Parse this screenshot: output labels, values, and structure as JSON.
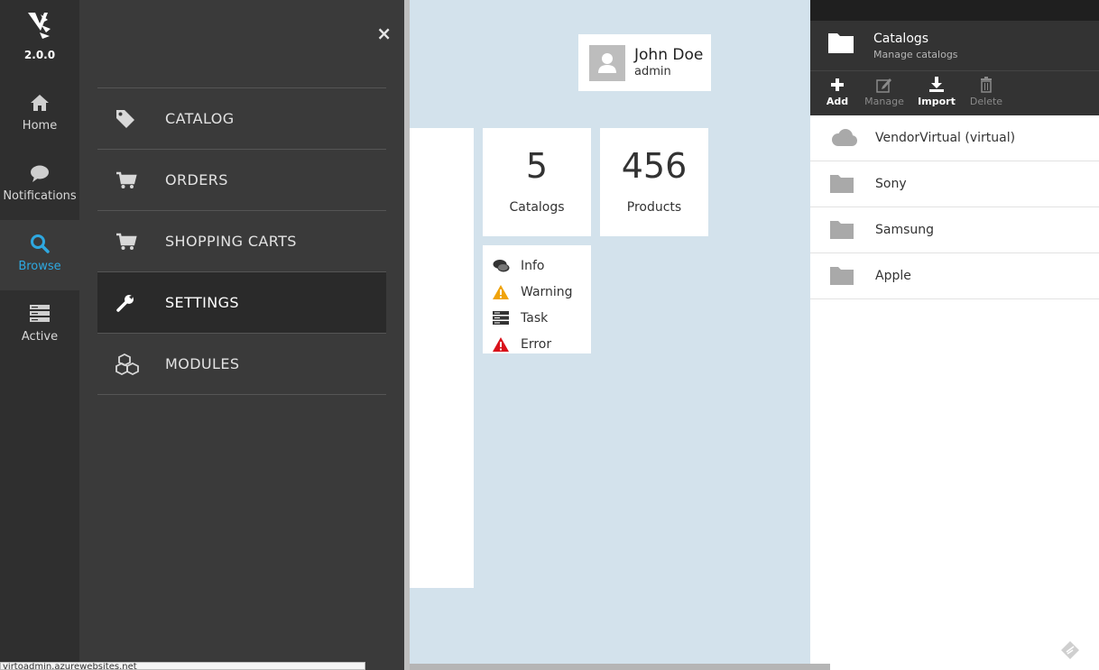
{
  "app": {
    "version": "2.0.0"
  },
  "sidebar": {
    "items": [
      {
        "label": "Home",
        "icon": "home-icon"
      },
      {
        "label": "Notifications",
        "icon": "chat-bubble-icon"
      },
      {
        "label": "Browse",
        "icon": "search-icon",
        "active": true
      },
      {
        "label": "Active",
        "icon": "server-stack-icon"
      }
    ],
    "accent_color": "#2ea8e0"
  },
  "menu": {
    "close_label": "×",
    "items": [
      {
        "label": "CATALOG",
        "icon": "tag-icon"
      },
      {
        "label": "ORDERS",
        "icon": "cart-icon"
      },
      {
        "label": "SHOPPING CARTS",
        "icon": "cart-icon"
      },
      {
        "label": "SETTINGS",
        "icon": "wrench-icon",
        "active": true
      },
      {
        "label": "MODULES",
        "icon": "cubes-icon"
      }
    ]
  },
  "user": {
    "name": "John Doe",
    "role": "admin"
  },
  "stats": [
    {
      "value": "5",
      "label": "Catalogs"
    },
    {
      "value": "456",
      "label": "Products"
    }
  ],
  "legend": [
    {
      "label": "Info",
      "icon": "chat-bubble-icon"
    },
    {
      "label": "Warning",
      "icon": "warning-triangle-icon",
      "color": "#f0a30a"
    },
    {
      "label": "Task",
      "icon": "server-stack-icon"
    },
    {
      "label": "Error",
      "icon": "error-triangle-icon",
      "color": "#d9121b"
    }
  ],
  "catalogs_panel": {
    "title": "Catalogs",
    "subtitle": "Manage catalogs",
    "toolbar": [
      {
        "label": "Add",
        "icon": "plus-icon",
        "enabled": true
      },
      {
        "label": "Manage",
        "icon": "edit-icon",
        "enabled": false
      },
      {
        "label": "Import",
        "icon": "download-icon",
        "enabled": true
      },
      {
        "label": "Delete",
        "icon": "trash-icon",
        "enabled": false
      }
    ],
    "items": [
      {
        "label": "VendorVirtual (virtual)",
        "icon": "cloud-icon"
      },
      {
        "label": "Sony",
        "icon": "folder-icon"
      },
      {
        "label": "Samsung",
        "icon": "folder-icon"
      },
      {
        "label": "Apple",
        "icon": "folder-icon"
      }
    ]
  },
  "statusbar": {
    "url": "virtoadmin.azurewebsites.net"
  }
}
